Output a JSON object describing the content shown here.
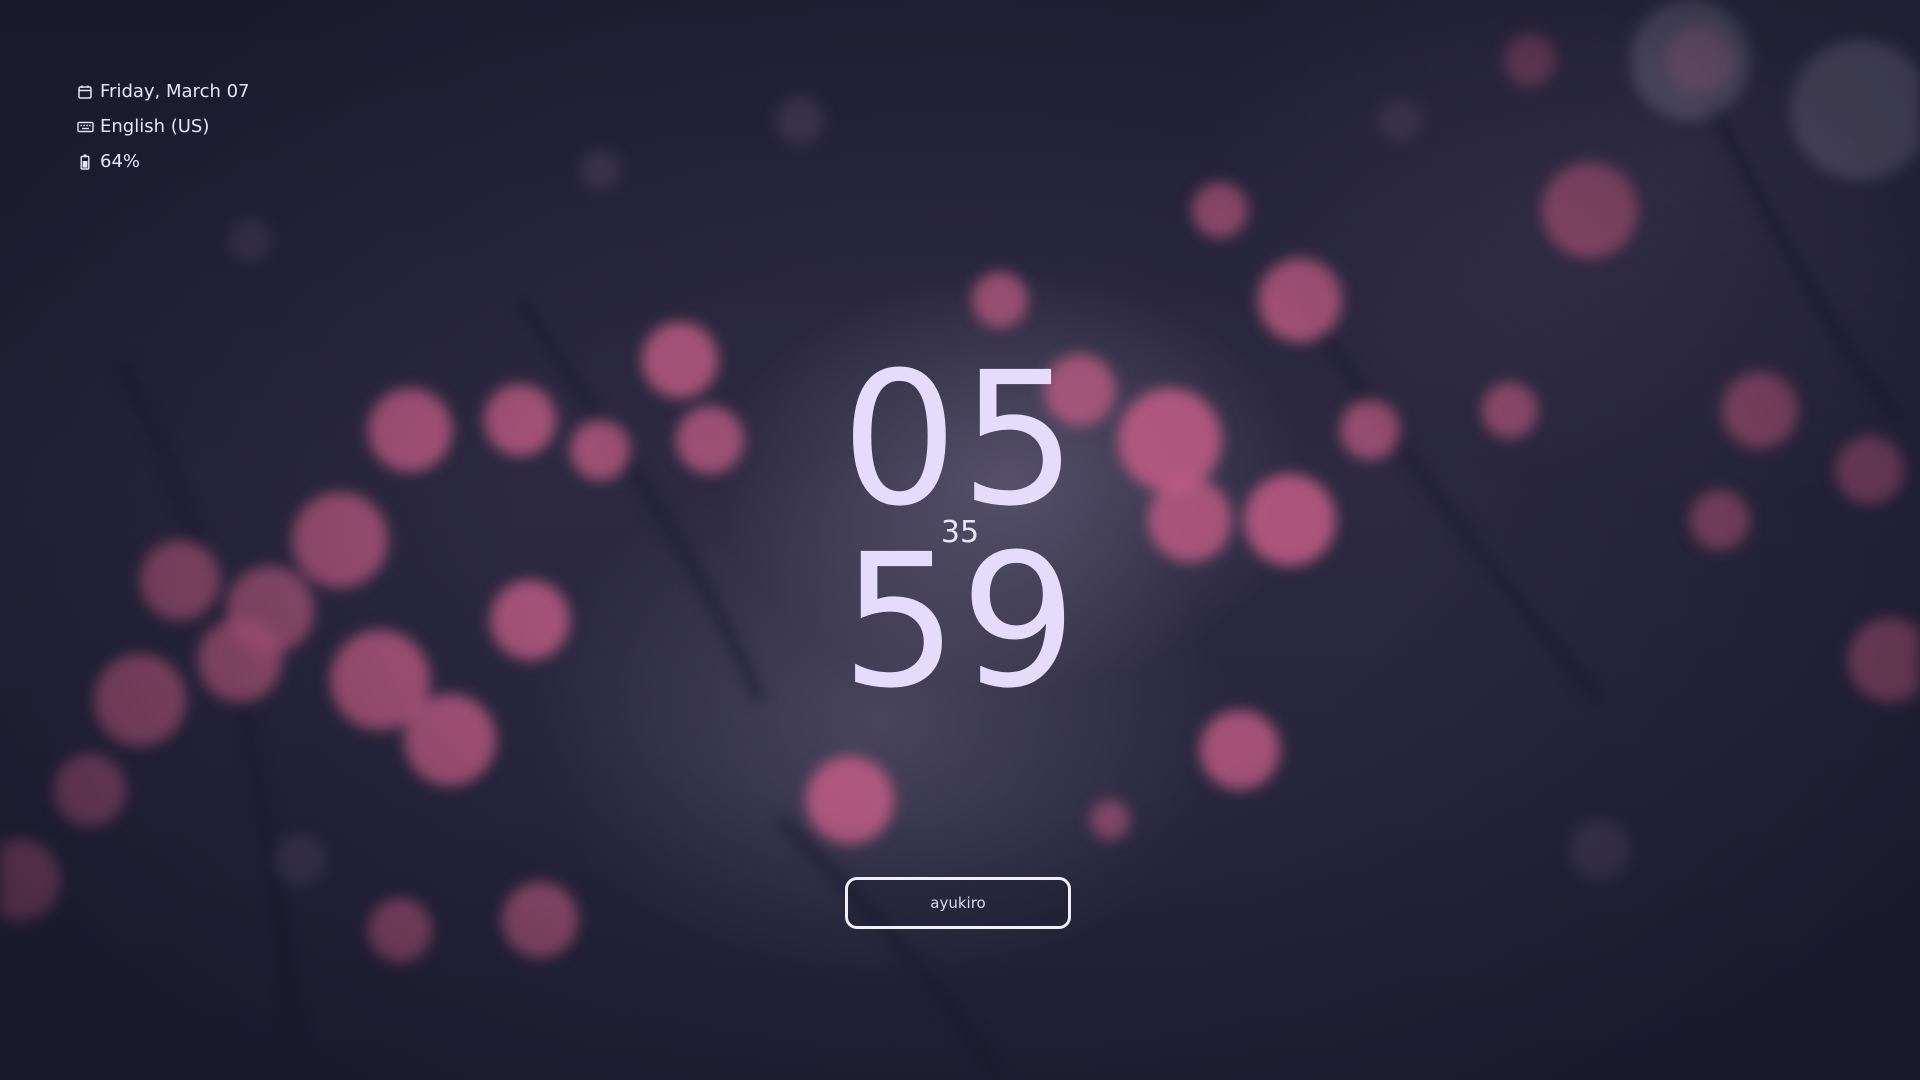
{
  "wallpaper": {
    "description_icon": "flower-wallpaper",
    "flower_color": "#c25d86",
    "base_color": "#26253b"
  },
  "status": {
    "date": {
      "icon": "calendar-icon",
      "text": "Friday, March 07"
    },
    "keyboard": {
      "icon": "keyboard-icon",
      "text": "English (US)"
    },
    "battery": {
      "icon": "battery-icon",
      "text": "64%"
    }
  },
  "clock": {
    "hours": "05",
    "seconds": "35",
    "minutes": "59"
  },
  "user": {
    "name": "ayukiro"
  },
  "colors": {
    "text": "#e4dcfa",
    "border": "#f2eef8"
  }
}
